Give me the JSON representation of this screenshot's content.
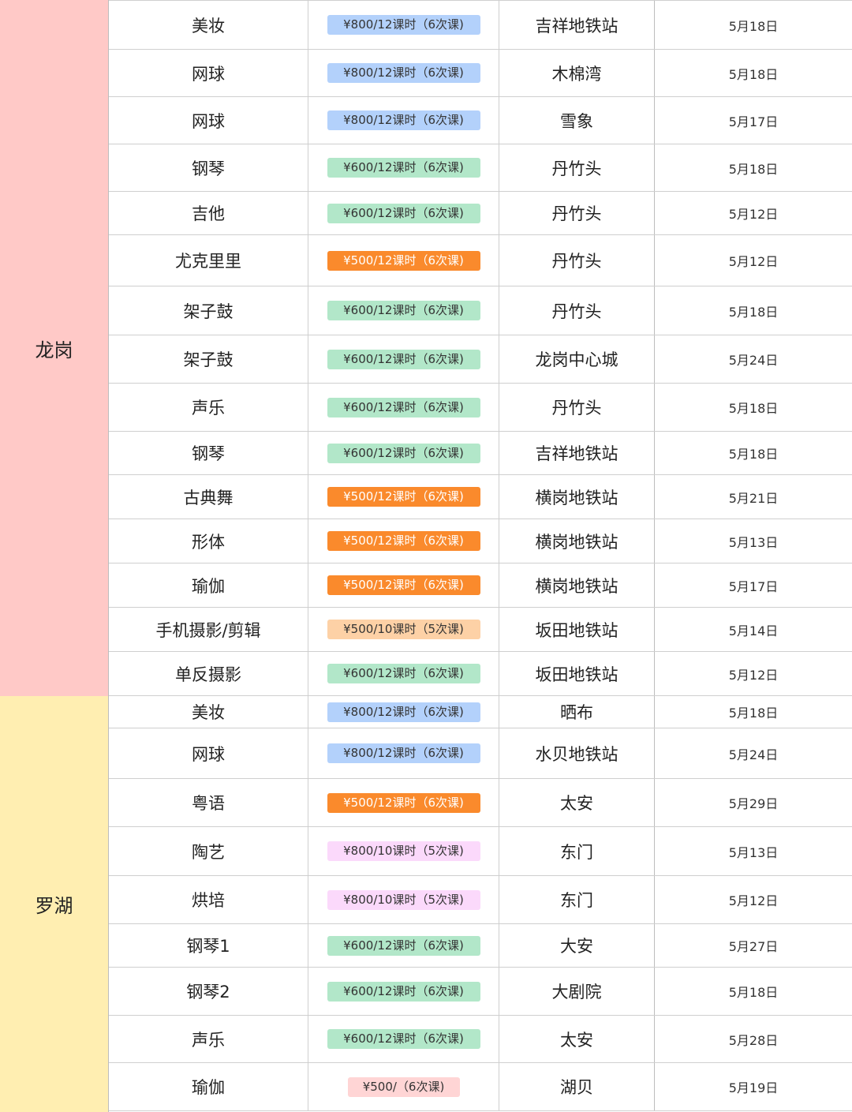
{
  "colors": {
    "region_longgang": "#ffc9c7",
    "region_luohu": "#ffeeb1",
    "pill_blue": {
      "bg": "#b3d1fb",
      "fg": "#333333"
    },
    "pill_green": {
      "bg": "#b2e7c9",
      "fg": "#333333"
    },
    "pill_orange": {
      "bg": "#fa8a2c",
      "fg": "#ffffff"
    },
    "pill_peach": {
      "bg": "#fdd1a6",
      "fg": "#333333"
    },
    "pill_pink": {
      "bg": "#fbd9fb",
      "fg": "#333333"
    },
    "pill_rose": {
      "bg": "#ffd5d5",
      "fg": "#333333"
    }
  },
  "regions": [
    {
      "name": "龙岗",
      "color_key": "region_longgang",
      "rows": [
        {
          "course": "美妆",
          "price": "¥800/12课时（6次课)",
          "price_style": "pill_blue",
          "location": "吉祥地铁站",
          "date": "5月18日"
        },
        {
          "course": "网球",
          "price": "¥800/12课时（6次课)",
          "price_style": "pill_blue",
          "location": "木棉湾",
          "date": "5月18日"
        },
        {
          "course": "网球",
          "price": "¥800/12课时（6次课)",
          "price_style": "pill_blue",
          "location": "雪象",
          "date": "5月17日"
        },
        {
          "course": "钢琴",
          "price": "¥600/12课时（6次课)",
          "price_style": "pill_green",
          "location": "丹竹头",
          "date": "5月18日"
        },
        {
          "course": "吉他",
          "price": "¥600/12课时（6次课)",
          "price_style": "pill_green",
          "location": "丹竹头",
          "date": "5月12日"
        },
        {
          "course": "尤克里里",
          "price": "¥500/12课时（6次课)",
          "price_style": "pill_orange",
          "location": "丹竹头",
          "date": "5月12日"
        },
        {
          "course": "架子鼓",
          "price": "¥600/12课时（6次课)",
          "price_style": "pill_green",
          "location": "丹竹头",
          "date": "5月18日"
        },
        {
          "course": "架子鼓",
          "price": "¥600/12课时（6次课)",
          "price_style": "pill_green",
          "location": "龙岗中心城",
          "date": "5月24日"
        },
        {
          "course": "声乐",
          "price": "¥600/12课时（6次课)",
          "price_style": "pill_green",
          "location": "丹竹头",
          "date": "5月18日"
        },
        {
          "course": "钢琴",
          "price": "¥600/12课时（6次课)",
          "price_style": "pill_green",
          "location": "吉祥地铁站",
          "date": "5月18日"
        },
        {
          "course": "古典舞",
          "price": "¥500/12课时（6次课)",
          "price_style": "pill_orange",
          "location": "横岗地铁站",
          "date": "5月21日"
        },
        {
          "course": "形体",
          "price": "¥500/12课时（6次课)",
          "price_style": "pill_orange",
          "location": "横岗地铁站",
          "date": "5月13日"
        },
        {
          "course": "瑜伽",
          "price": "¥500/12课时（6次课)",
          "price_style": "pill_orange",
          "location": "横岗地铁站",
          "date": "5月17日"
        },
        {
          "course": "手机摄影/剪辑",
          "price": "¥500/10课时（5次课)",
          "price_style": "pill_peach",
          "location": "坂田地铁站",
          "date": "5月14日"
        },
        {
          "course": "单反摄影",
          "price": "¥600/12课时（6次课)",
          "price_style": "pill_green",
          "location": "坂田地铁站",
          "date": "5月12日"
        }
      ]
    },
    {
      "name": "罗湖",
      "color_key": "region_luohu",
      "rows": [
        {
          "course": "美妆",
          "price": "¥800/12课时（6次课)",
          "price_style": "pill_blue",
          "location": "晒布",
          "date": "5月18日"
        },
        {
          "course": "网球",
          "price": "¥800/12课时（6次课)",
          "price_style": "pill_blue",
          "location": "水贝地铁站",
          "date": "5月24日"
        },
        {
          "course": "粤语",
          "price": "¥500/12课时（6次课)",
          "price_style": "pill_orange",
          "location": "太安",
          "date": "5月29日"
        },
        {
          "course": "陶艺",
          "price": "¥800/10课时（5次课)",
          "price_style": "pill_pink",
          "location": "东门",
          "date": "5月13日"
        },
        {
          "course": "烘培",
          "price": "¥800/10课时（5次课)",
          "price_style": "pill_pink",
          "location": "东门",
          "date": "5月12日"
        },
        {
          "course": "钢琴1",
          "price": "¥600/12课时（6次课)",
          "price_style": "pill_green",
          "location": "大安",
          "date": "5月27日"
        },
        {
          "course": "钢琴2",
          "price": "¥600/12课时（6次课)",
          "price_style": "pill_green",
          "location": "大剧院",
          "date": "5月18日"
        },
        {
          "course": "声乐",
          "price": "¥600/12课时（6次课)",
          "price_style": "pill_green",
          "location": "太安",
          "date": "5月28日"
        },
        {
          "course": "瑜伽",
          "price": "¥500/（6次课)",
          "price_style": "pill_rose",
          "location": "湖贝",
          "date": "5月19日"
        }
      ]
    }
  ]
}
